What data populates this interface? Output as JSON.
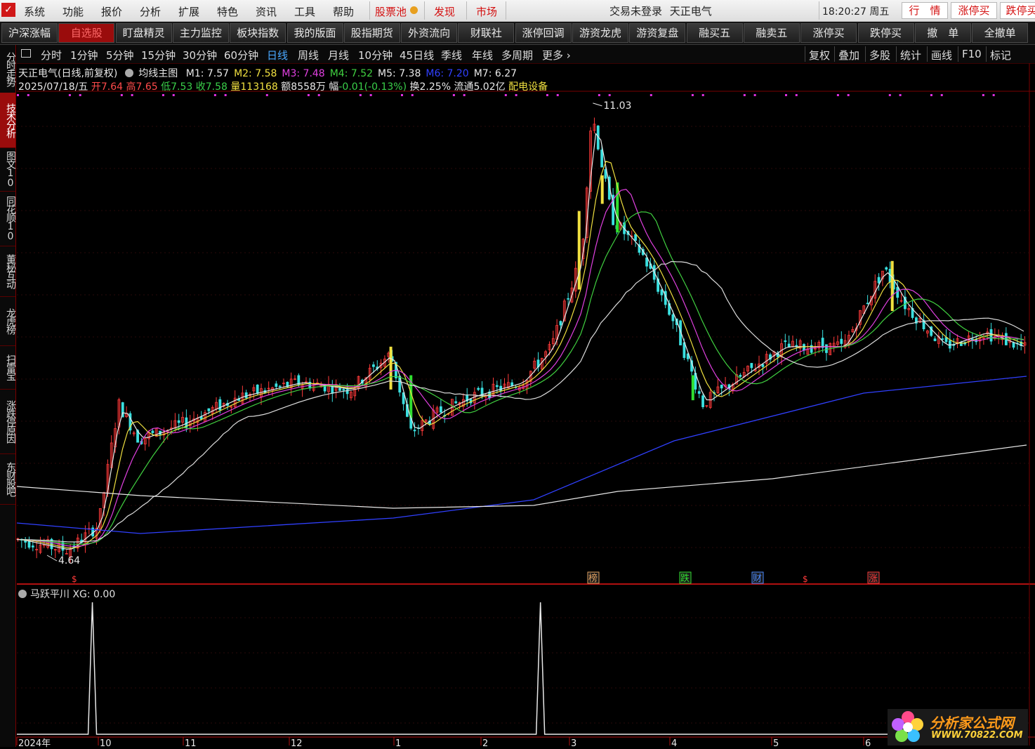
{
  "menu": {
    "items": [
      "系统",
      "功能",
      "报价",
      "分析",
      "扩展",
      "特色",
      "资讯",
      "工具",
      "帮助"
    ],
    "stock_pool": "股票池",
    "discover": "发现",
    "market": "市场",
    "login_status": "交易未登录",
    "stock_name": "天正电气",
    "clock": "18:20:27 周五",
    "right_buttons": [
      "行　情",
      "涨停买",
      "跌停买"
    ]
  },
  "toolbar": [
    "沪深涨幅",
    "自选股",
    "盯盘精灵",
    "主力监控",
    "板块指数",
    "我的版面",
    "股指期货",
    "外资流向",
    "财联社",
    "涨停回调",
    "游资龙虎",
    "游资复盘",
    "融买五",
    "融卖五",
    "涨停买",
    "跌停买",
    "撤　单",
    "全撤单"
  ],
  "periods": [
    "分时",
    "1分钟",
    "5分钟",
    "15分钟",
    "30分钟",
    "60分钟",
    "日线",
    "周线",
    "月线",
    "10分钟",
    "45日线",
    "季线",
    "年线",
    "多周期",
    "更多"
  ],
  "active_period": "日线",
  "right_tools": [
    "复权",
    "叠加",
    "多股",
    "统计",
    "画线",
    "F10",
    "标记"
  ],
  "side_tabs": [
    "分时走势",
    "技术分析",
    "图文10",
    "同花顺10",
    "董秘互动",
    "龙虎榜",
    "扫雷宝",
    "涨跌停原因",
    "东财股吧"
  ],
  "chart_header": {
    "title": "天正电气(日线,前复权)",
    "indicator": "均线主图",
    "ma": [
      {
        "label": "M1:",
        "value": "7.57",
        "color": "#e8e8e8"
      },
      {
        "label": "M2:",
        "value": "7.58",
        "color": "#f0e040"
      },
      {
        "label": "M3:",
        "value": "7.48",
        "color": "#e040e0"
      },
      {
        "label": "M4:",
        "value": "7.52",
        "color": "#40d040"
      },
      {
        "label": "M5:",
        "value": "7.38",
        "color": "#e8e8e8"
      },
      {
        "label": "M6:",
        "value": "7.20",
        "color": "#3040ff"
      },
      {
        "label": "M7:",
        "value": "6.27",
        "color": "#e8e8e8"
      }
    ],
    "date": "2025/07/18/五",
    "open_label": "开",
    "open": "7.64",
    "high_label": "高",
    "high": "7.65",
    "low_label": "低",
    "low": "7.53",
    "close_label": "收",
    "close": "7.58",
    "vol_label": "量",
    "vol": "113168",
    "amt_label": "额",
    "amt": "8558万",
    "chg_label": "幅",
    "chg": "-0.01(-0.13%)",
    "turn_label": "换",
    "turn": "2.25%",
    "float_label": "流通",
    "float": "5.02亿",
    "sector": "配电设备"
  },
  "annotations": {
    "max_label": "11.03",
    "min_label": "4.64"
  },
  "event_markers": [
    "$",
    "榜",
    "跌",
    "财",
    "$",
    "涨"
  ],
  "indicator_panel": {
    "title": "马跃平川 XG: 0.00"
  },
  "x_axis": [
    "2024年",
    "10",
    "11",
    "12",
    "1",
    "2",
    "3",
    "4",
    "5",
    "6"
  ],
  "chart_data": {
    "type": "line",
    "title": "天正电气(日线,前复权)",
    "y_range": [
      4.64,
      11.03
    ],
    "price_high": 11.03,
    "price_low": 4.64,
    "x_ticks": [
      "2024年",
      "10",
      "11",
      "12",
      "1",
      "2",
      "3",
      "4",
      "5",
      "6"
    ],
    "close_path": [
      {
        "t": 0.0,
        "v": 4.9
      },
      {
        "t": 0.05,
        "v": 4.75
      },
      {
        "t": 0.08,
        "v": 5.1
      },
      {
        "t": 0.1,
        "v": 6.8
      },
      {
        "t": 0.12,
        "v": 6.3
      },
      {
        "t": 0.16,
        "v": 6.5
      },
      {
        "t": 0.22,
        "v": 6.9
      },
      {
        "t": 0.28,
        "v": 7.1
      },
      {
        "t": 0.33,
        "v": 7.0
      },
      {
        "t": 0.37,
        "v": 7.5
      },
      {
        "t": 0.39,
        "v": 6.4
      },
      {
        "t": 0.42,
        "v": 6.7
      },
      {
        "t": 0.45,
        "v": 6.9
      },
      {
        "t": 0.5,
        "v": 7.1
      },
      {
        "t": 0.53,
        "v": 7.6
      },
      {
        "t": 0.56,
        "v": 8.9
      },
      {
        "t": 0.57,
        "v": 10.9
      },
      {
        "t": 0.59,
        "v": 9.4
      },
      {
        "t": 0.62,
        "v": 8.9
      },
      {
        "t": 0.65,
        "v": 8.0
      },
      {
        "t": 0.68,
        "v": 6.8
      },
      {
        "t": 0.72,
        "v": 7.2
      },
      {
        "t": 0.76,
        "v": 7.6
      },
      {
        "t": 0.82,
        "v": 7.6
      },
      {
        "t": 0.86,
        "v": 8.7
      },
      {
        "t": 0.88,
        "v": 8.2
      },
      {
        "t": 0.92,
        "v": 7.6
      },
      {
        "t": 0.96,
        "v": 7.8
      },
      {
        "t": 1.0,
        "v": 7.58
      }
    ],
    "indicator_series": {
      "name": "XG",
      "peaks_at": [
        0.075,
        0.52
      ],
      "value": 0.0
    }
  }
}
